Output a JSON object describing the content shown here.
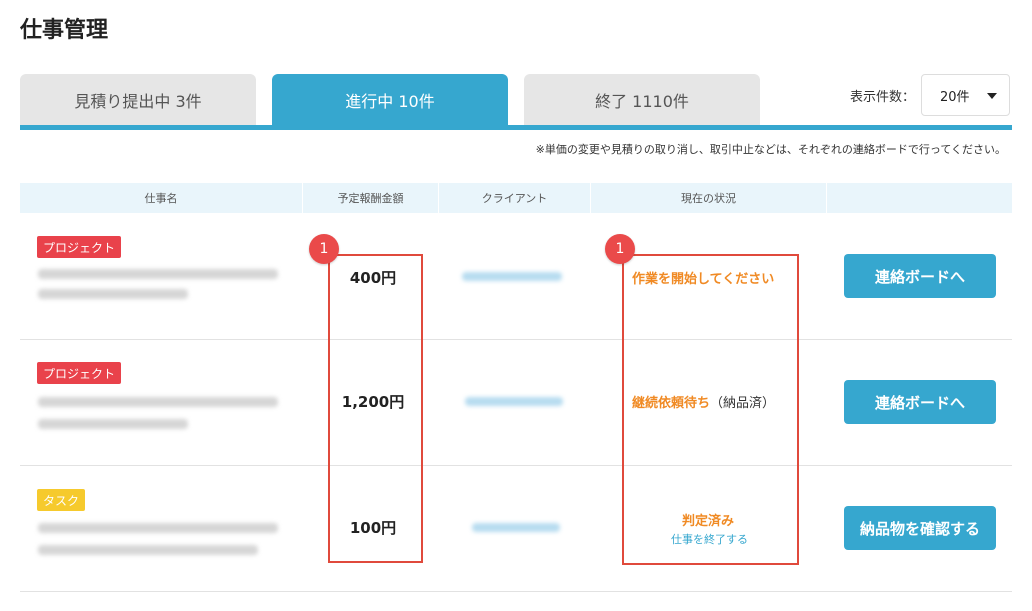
{
  "page_title": "仕事管理",
  "tabs": [
    {
      "label": "見積り提出中 3件",
      "active": false
    },
    {
      "label": "進行中 10件",
      "active": true
    },
    {
      "label": "終了 1110件",
      "active": false
    }
  ],
  "per_page": {
    "label": "表示件数：",
    "value": "20件"
  },
  "note": "※単価の変更や見積りの取り消し、取引中止などは、それぞれの連絡ボードで行ってください。",
  "columns": [
    "仕事名",
    "予定報酬金額",
    "クライアント",
    "現在の状況",
    ""
  ],
  "rows": [
    {
      "badge": "プロジェクト",
      "badge_type": "project",
      "price": "400円",
      "status": "作業を開始してください",
      "status_suffix": "",
      "status_link": "",
      "action": "連絡ボードへ"
    },
    {
      "badge": "プロジェクト",
      "badge_type": "project",
      "price": "1,200円",
      "status": "継続依頼待ち",
      "status_suffix": "（納品済）",
      "status_link": "",
      "action": "連絡ボードへ"
    },
    {
      "badge": "タスク",
      "badge_type": "task",
      "price": "100円",
      "status": "判定済み",
      "status_suffix": "",
      "status_link": "仕事を終了する",
      "action": "納品物を確認する"
    }
  ],
  "markers": [
    "1",
    "1"
  ],
  "colors": {
    "accent": "#36a7cf",
    "project_badge": "#e9424b",
    "task_badge": "#f6ca2d",
    "status_orange": "#f08a24",
    "highlight": "#e04a3c"
  }
}
